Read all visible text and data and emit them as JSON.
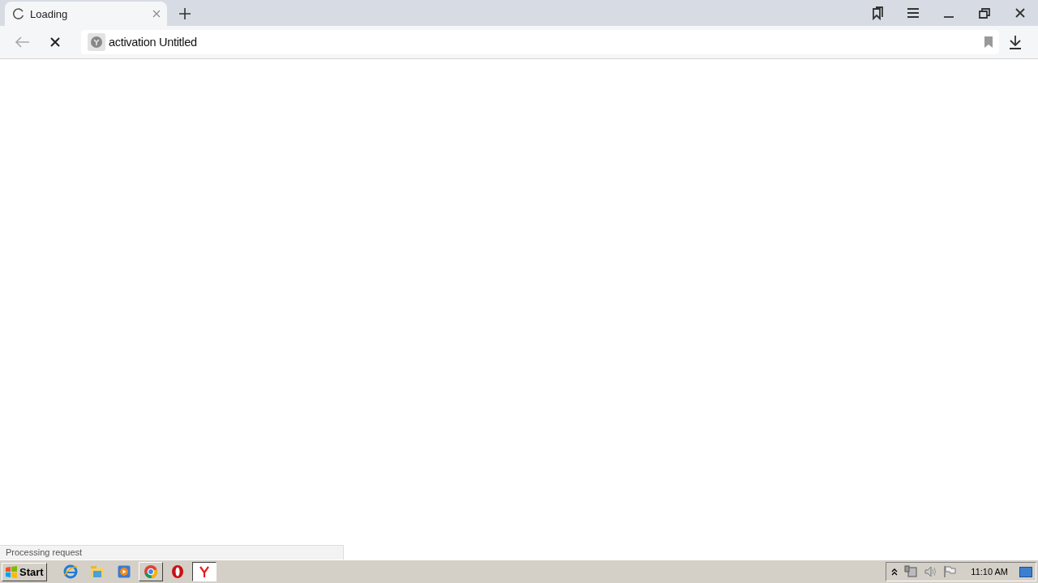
{
  "tab": {
    "title": "Loading",
    "loading": true
  },
  "address_bar": {
    "text": "activation Untitled"
  },
  "status_bar": {
    "text": "Processing request"
  },
  "taskbar": {
    "start": "Start",
    "apps": [
      {
        "kind": "ie",
        "running": false,
        "selected": false
      },
      {
        "kind": "explorer",
        "running": false,
        "selected": false
      },
      {
        "kind": "media",
        "running": false,
        "selected": false
      },
      {
        "kind": "chrome",
        "running": true,
        "selected": false
      },
      {
        "kind": "opera",
        "running": false,
        "selected": false
      },
      {
        "kind": "yandex",
        "running": true,
        "selected": true
      }
    ],
    "clock": "11:10 AM"
  }
}
